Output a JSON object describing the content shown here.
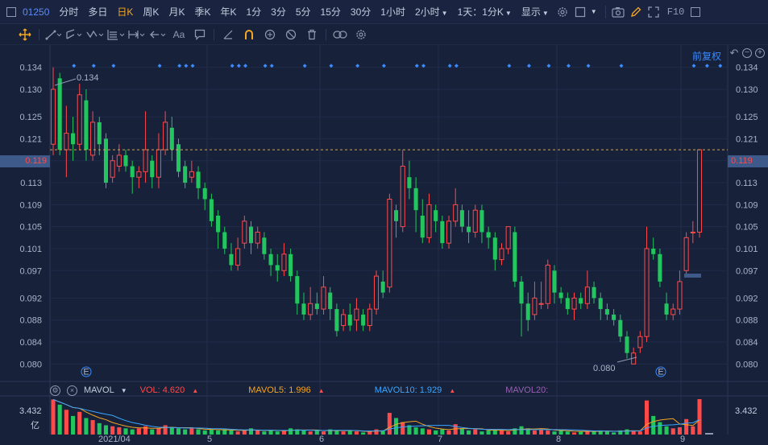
{
  "toolbar": {
    "code": "01250",
    "items": [
      "分时",
      "多日",
      "日K",
      "周K",
      "月K",
      "季K",
      "年K",
      "1分",
      "3分",
      "5分",
      "15分",
      "30分",
      "1小时",
      "2小时",
      "1天：1分K",
      "显示"
    ],
    "active": "日K",
    "f10": "F10"
  },
  "drawbar": {
    "text_tool": "Aa"
  },
  "restore_label": "前复权",
  "price_axis": {
    "ticks": [
      "0.134",
      "0.130",
      "0.125",
      "0.121",
      "0.117",
      "0.113",
      "0.109",
      "0.105",
      "0.101",
      "0.097",
      "0.092",
      "0.088",
      "0.084",
      "0.080"
    ],
    "current": "0.119",
    "max_label": "0.134",
    "min_label": "0.080"
  },
  "volume": {
    "name": "MAVOL",
    "vol": "VOL: 4.620",
    "ma5": "MAVOL5: 1.996",
    "ma10": "MAVOL10: 1.929",
    "ma20": "MAVOL20:",
    "max_value": "3.432",
    "unit": "亿"
  },
  "date_axis": [
    "2021/04",
    "5",
    "6",
    "7",
    "8",
    "9"
  ],
  "event_marker": "E",
  "colors": {
    "up": "#ff4a4a",
    "down": "#22c55e",
    "accent": "#f5a623",
    "link": "#3a8bff"
  },
  "chart_data": {
    "type": "candlestick",
    "ohlc": [
      [
        0.12,
        0.13,
        0.118,
        0.134
      ],
      [
        0.132,
        0.119,
        0.118,
        0.133
      ],
      [
        0.119,
        0.122,
        0.114,
        0.127
      ],
      [
        0.122,
        0.12,
        0.117,
        0.125
      ],
      [
        0.12,
        0.129,
        0.119,
        0.131
      ],
      [
        0.128,
        0.119,
        0.117,
        0.13
      ],
      [
        0.118,
        0.124,
        0.117,
        0.126
      ],
      [
        0.124,
        0.12,
        0.118,
        0.125
      ],
      [
        0.121,
        0.113,
        0.112,
        0.122
      ],
      [
        0.114,
        0.117,
        0.113,
        0.118
      ],
      [
        0.116,
        0.118,
        0.115,
        0.12
      ],
      [
        0.118,
        0.116,
        0.115,
        0.119
      ],
      [
        0.116,
        0.114,
        0.111,
        0.117
      ],
      [
        0.114,
        0.115,
        0.112,
        0.116
      ],
      [
        0.115,
        0.119,
        0.113,
        0.126
      ],
      [
        0.117,
        0.114,
        0.112,
        0.118
      ],
      [
        0.114,
        0.119,
        0.112,
        0.122
      ],
      [
        0.119,
        0.124,
        0.118,
        0.126
      ],
      [
        0.123,
        0.119,
        0.117,
        0.125
      ],
      [
        0.12,
        0.115,
        0.114,
        0.121
      ],
      [
        0.116,
        0.113,
        0.112,
        0.117
      ],
      [
        0.114,
        0.115,
        0.113,
        0.117
      ],
      [
        0.115,
        0.112,
        0.11,
        0.116
      ],
      [
        0.112,
        0.11,
        0.108,
        0.113
      ],
      [
        0.11,
        0.106,
        0.105,
        0.111
      ],
      [
        0.107,
        0.104,
        0.101,
        0.108
      ],
      [
        0.104,
        0.101,
        0.1,
        0.105
      ],
      [
        0.1,
        0.098,
        0.097,
        0.102
      ],
      [
        0.098,
        0.101,
        0.097,
        0.103
      ],
      [
        0.102,
        0.106,
        0.101,
        0.107
      ],
      [
        0.105,
        0.102,
        0.1,
        0.106
      ],
      [
        0.102,
        0.104,
        0.101,
        0.105
      ],
      [
        0.103,
        0.1,
        0.099,
        0.104
      ],
      [
        0.1,
        0.098,
        0.096,
        0.101
      ],
      [
        0.098,
        0.097,
        0.095,
        0.1
      ],
      [
        0.097,
        0.1,
        0.096,
        0.102
      ],
      [
        0.1,
        0.096,
        0.095,
        0.101
      ],
      [
        0.096,
        0.091,
        0.089,
        0.097
      ],
      [
        0.091,
        0.089,
        0.088,
        0.093
      ],
      [
        0.089,
        0.091,
        0.088,
        0.094
      ],
      [
        0.091,
        0.09,
        0.089,
        0.093
      ],
      [
        0.09,
        0.094,
        0.089,
        0.096
      ],
      [
        0.093,
        0.09,
        0.088,
        0.094
      ],
      [
        0.09,
        0.086,
        0.085,
        0.091
      ],
      [
        0.087,
        0.089,
        0.086,
        0.09
      ],
      [
        0.089,
        0.087,
        0.086,
        0.091
      ],
      [
        0.088,
        0.09,
        0.086,
        0.092
      ],
      [
        0.089,
        0.087,
        0.086,
        0.09
      ],
      [
        0.087,
        0.09,
        0.086,
        0.091
      ],
      [
        0.09,
        0.096,
        0.089,
        0.097
      ],
      [
        0.095,
        0.093,
        0.092,
        0.097
      ],
      [
        0.094,
        0.11,
        0.093,
        0.111
      ],
      [
        0.108,
        0.106,
        0.103,
        0.109
      ],
      [
        0.105,
        0.116,
        0.104,
        0.119
      ],
      [
        0.114,
        0.112,
        0.11,
        0.117
      ],
      [
        0.112,
        0.108,
        0.104,
        0.114
      ],
      [
        0.107,
        0.103,
        0.102,
        0.11
      ],
      [
        0.103,
        0.109,
        0.102,
        0.111
      ],
      [
        0.108,
        0.106,
        0.104,
        0.109
      ],
      [
        0.106,
        0.102,
        0.101,
        0.107
      ],
      [
        0.102,
        0.106,
        0.101,
        0.107
      ],
      [
        0.106,
        0.109,
        0.105,
        0.112
      ],
      [
        0.108,
        0.105,
        0.104,
        0.109
      ],
      [
        0.105,
        0.104,
        0.102,
        0.108
      ],
      [
        0.104,
        0.108,
        0.103,
        0.109
      ],
      [
        0.108,
        0.104,
        0.102,
        0.109
      ],
      [
        0.104,
        0.103,
        0.101,
        0.105
      ],
      [
        0.103,
        0.099,
        0.097,
        0.104
      ],
      [
        0.099,
        0.101,
        0.098,
        0.102
      ],
      [
        0.101,
        0.105,
        0.1,
        0.105
      ],
      [
        0.104,
        0.095,
        0.094,
        0.105
      ],
      [
        0.095,
        0.091,
        0.085,
        0.096
      ],
      [
        0.091,
        0.088,
        0.086,
        0.093
      ],
      [
        0.089,
        0.092,
        0.088,
        0.095
      ],
      [
        0.091,
        0.091,
        0.09,
        0.095
      ],
      [
        0.091,
        0.098,
        0.09,
        0.099
      ],
      [
        0.097,
        0.093,
        0.091,
        0.098
      ],
      [
        0.093,
        0.092,
        0.091,
        0.094
      ],
      [
        0.092,
        0.09,
        0.089,
        0.093
      ],
      [
        0.09,
        0.092,
        0.088,
        0.093
      ],
      [
        0.092,
        0.091,
        0.09,
        0.093
      ],
      [
        0.091,
        0.094,
        0.09,
        0.097
      ],
      [
        0.094,
        0.092,
        0.091,
        0.095
      ],
      [
        0.092,
        0.09,
        0.088,
        0.093
      ],
      [
        0.09,
        0.089,
        0.088,
        0.091
      ],
      [
        0.089,
        0.088,
        0.087,
        0.09
      ],
      [
        0.088,
        0.085,
        0.084,
        0.089
      ],
      [
        0.085,
        0.082,
        0.081,
        0.086
      ],
      [
        0.08,
        0.082,
        0.08,
        0.083
      ],
      [
        0.083,
        0.085,
        0.082,
        0.086
      ],
      [
        0.085,
        0.101,
        0.084,
        0.105
      ],
      [
        0.101,
        0.1,
        0.099,
        0.103
      ],
      [
        0.1,
        0.095,
        0.094,
        0.101
      ],
      [
        0.091,
        0.089,
        0.088,
        0.093
      ],
      [
        0.089,
        0.09,
        0.088,
        0.091
      ],
      [
        0.09,
        0.095,
        0.089,
        0.097
      ],
      [
        0.097,
        0.103,
        0.096,
        0.104
      ],
      [
        0.104,
        0.104,
        0.102,
        0.106
      ],
      [
        0.104,
        0.119,
        0.103,
        0.119
      ]
    ],
    "volume": [
      3.4,
      2.9,
      2.4,
      1.8,
      2.2,
      1.6,
      1.4,
      1.1,
      0.9,
      0.8,
      0.7,
      0.6,
      0.5,
      0.6,
      0.8,
      0.5,
      0.6,
      0.9,
      0.7,
      0.6,
      0.5,
      0.6,
      0.5,
      0.4,
      0.5,
      0.4,
      0.5,
      0.4,
      0.3,
      0.4,
      0.6,
      0.4,
      0.3,
      0.4,
      0.3,
      0.4,
      0.6,
      0.5,
      0.4,
      0.3,
      0.4,
      0.3,
      0.5,
      0.4,
      0.3,
      0.4,
      0.3,
      0.2,
      0.3,
      0.5,
      0.4,
      2.1,
      1.6,
      1.2,
      0.9,
      0.7,
      0.6,
      0.5,
      0.4,
      0.5,
      0.4,
      1.0,
      0.6,
      0.4,
      0.5,
      0.3,
      0.4,
      0.5,
      0.4,
      0.3,
      0.6,
      0.8,
      0.6,
      0.4,
      0.5,
      0.4,
      0.3,
      0.4,
      0.3,
      0.2,
      0.3,
      0.4,
      0.3,
      0.4,
      0.3,
      0.2,
      0.4,
      0.5,
      0.4,
      0.3,
      3.3,
      1.8,
      1.2,
      0.8,
      0.6,
      0.7,
      1.5,
      0.8,
      3.43
    ],
    "ylim": [
      0.078,
      0.136
    ]
  }
}
